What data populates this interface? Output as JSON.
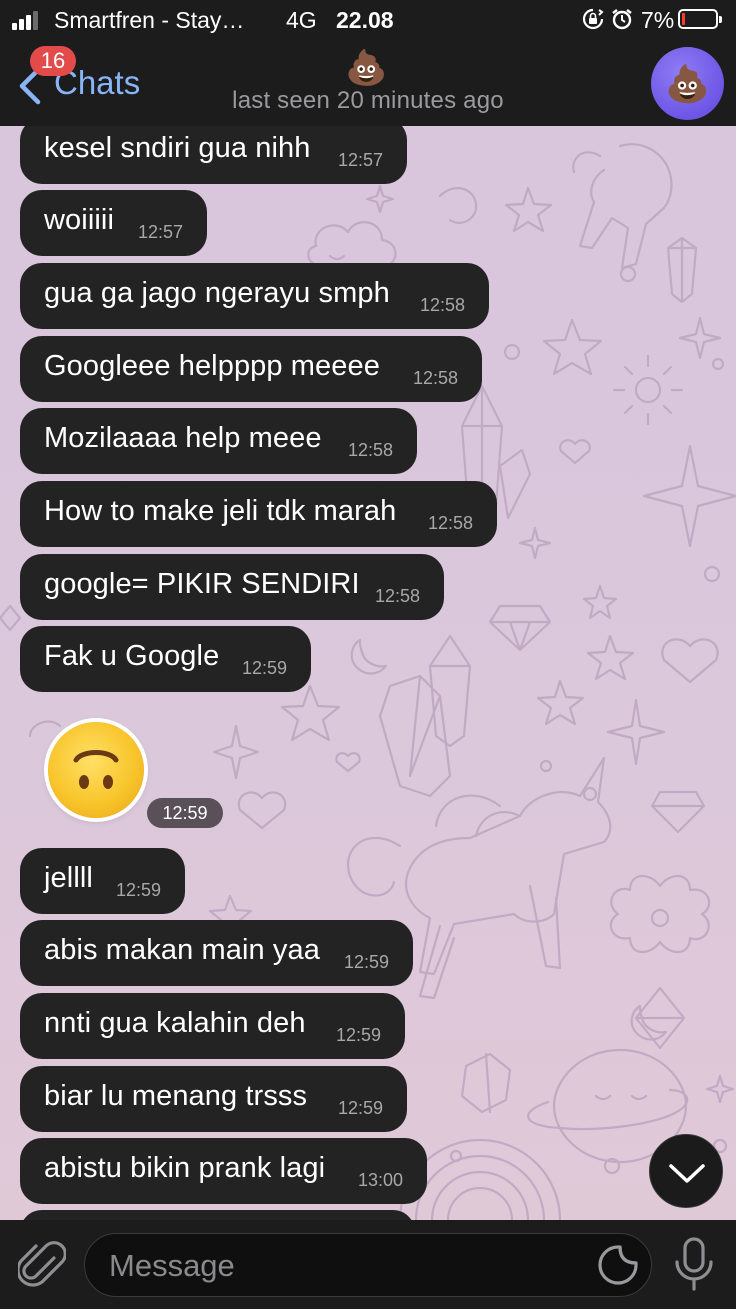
{
  "status_bar": {
    "carrier": "Smartfren - Stay…",
    "network": "4G",
    "time": "22.08",
    "battery_percent": "7%",
    "battery_level": 0.07,
    "signal_bars": 3,
    "icons": [
      "screen-rotation-lock-icon",
      "alarm-icon",
      "battery-icon"
    ]
  },
  "header": {
    "back_label": "Chats",
    "unread_badge": "16",
    "contact_emoji": "💩",
    "last_seen": "last seen 20 minutes ago",
    "avatar_emoji": "💩"
  },
  "messages": [
    {
      "text": "kesel sndiri gua nihh",
      "time": "12:57"
    },
    {
      "text": "woiiiii",
      "time": "12:57"
    },
    {
      "text": "gua ga jago ngerayu smph",
      "time": "12:58"
    },
    {
      "text": "Googleee helpppp meeee",
      "time": "12:58"
    },
    {
      "text": "Mozilaaaa help meee",
      "time": "12:58"
    },
    {
      "text": "How to make jeli tdk marah",
      "time": "12:58"
    },
    {
      "text": "google= PIKIR SENDIRI",
      "time": "12:58"
    },
    {
      "text": "Fak u Google",
      "time": "12:59"
    },
    {
      "text": "jellll",
      "time": "12:59"
    },
    {
      "text": "abis makan main yaa",
      "time": "12:59"
    },
    {
      "text": "nnti gua kalahin deh",
      "time": "12:59"
    },
    {
      "text": "biar lu menang trsss",
      "time": "12:59"
    },
    {
      "text": "abistu bikin prank lagi",
      "time": "13:00"
    }
  ],
  "sticker": {
    "name": "upside-down-face",
    "time": "12:59"
  },
  "input": {
    "placeholder": "Message"
  },
  "colors": {
    "bar_background": "#1c1c1d",
    "bubble_background": "#232323",
    "chat_background": "#dcc5dc",
    "accent_blue": "#8ab4f8",
    "badge_red": "#e34a4a",
    "battery_low": "#ff3b30"
  }
}
